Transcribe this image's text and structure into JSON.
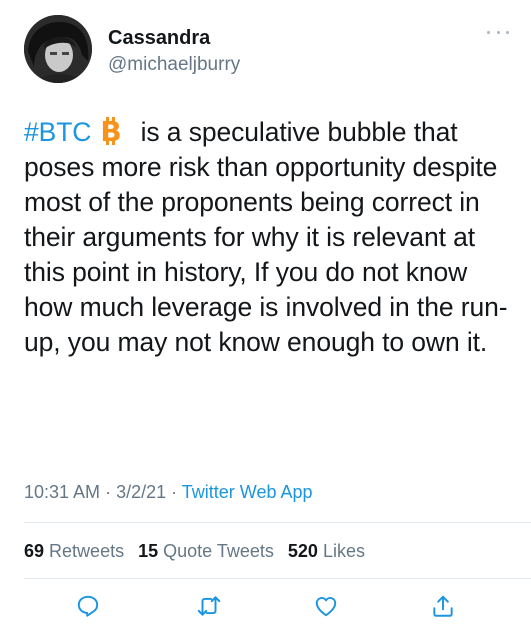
{
  "author": {
    "name": "Cassandra",
    "handle": "@michaeljburry"
  },
  "tweet": {
    "hashtag": "#BTC",
    "text_after_icon": " is a speculative bubble that poses more risk than opportunity despite most of the proponents being correct in their arguments for why it is relevant at this point in history, If you do not know how much leverage is involved in the run-up, you may not know enough to own it.",
    "emoji": "bitcoin-icon"
  },
  "meta": {
    "time": "10:31 AM",
    "sep1": " · ",
    "date": "3/2/21",
    "sep2": " · ",
    "source": "Twitter Web App"
  },
  "stats": {
    "retweets_count": "69",
    "retweets_label": "Retweets",
    "quotes_count": "15",
    "quotes_label": "Quote Tweets",
    "likes_count": "520",
    "likes_label": "Likes"
  },
  "colors": {
    "accent": "#1b95e0",
    "bitcoin": "#f7931a",
    "secondary_text": "#657786"
  },
  "icons": [
    "more-icon",
    "bitcoin-icon",
    "reply-icon",
    "retweet-icon",
    "like-icon",
    "share-icon"
  ]
}
